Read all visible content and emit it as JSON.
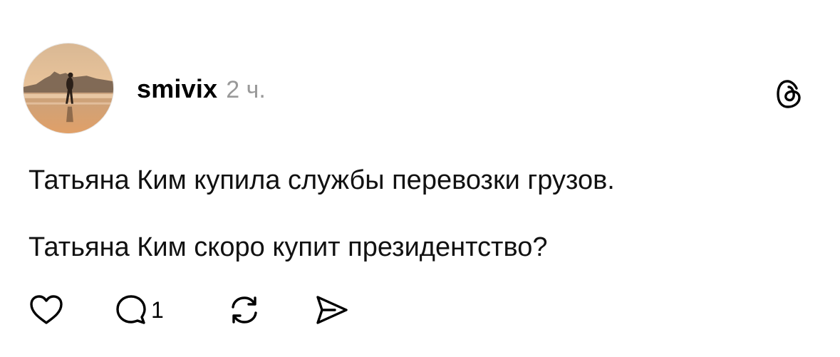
{
  "post": {
    "author": {
      "username": "smivix",
      "avatar": "photo-person-walking-on-beach-at-sunset"
    },
    "time_ago": "2 ч.",
    "app_logo": "threads-logo-icon",
    "lines": [
      "Татьяна Ким купила службы перевозки грузов.",
      "Татьяна Ким скоро купит президентство?"
    ],
    "actions": {
      "like": {
        "icon": "heart-icon"
      },
      "reply": {
        "icon": "comment-bubble-icon",
        "count": "1"
      },
      "repost": {
        "icon": "repost-arrows-icon"
      },
      "share": {
        "icon": "send-plane-icon"
      }
    }
  }
}
